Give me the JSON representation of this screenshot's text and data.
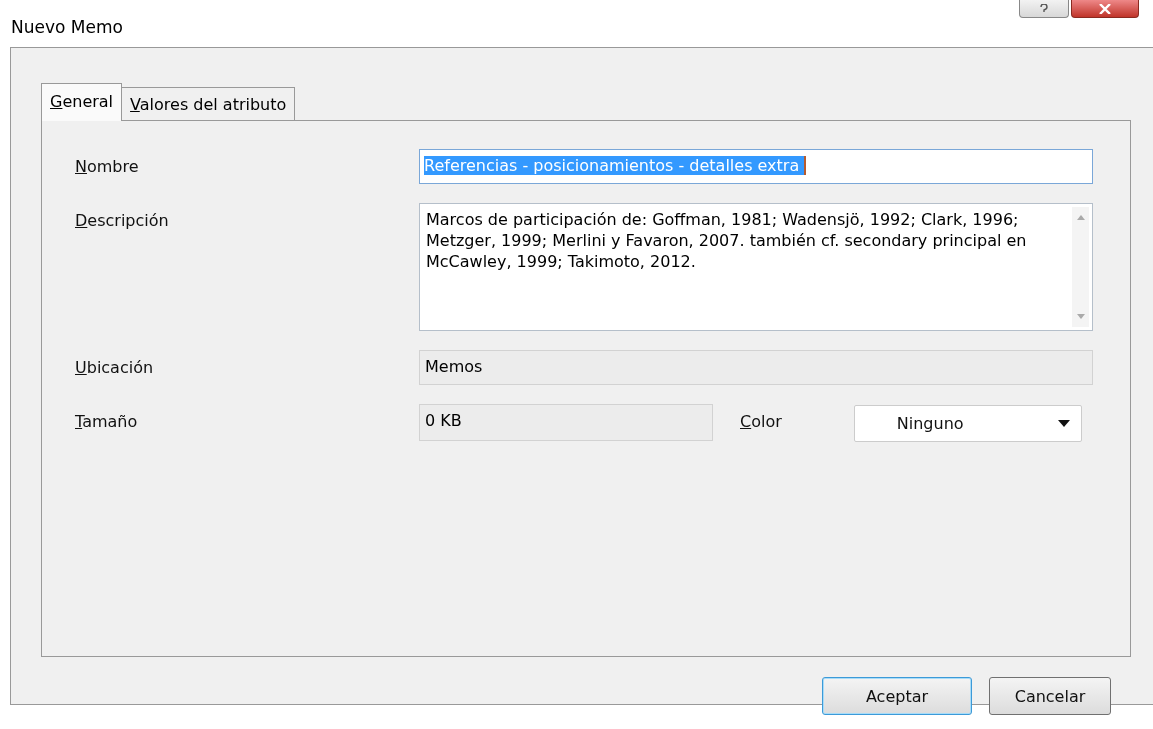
{
  "window": {
    "title": "Nuevo Memo"
  },
  "tabs": [
    {
      "label": "General",
      "selected": true
    },
    {
      "label": "Valores del atributo",
      "selected": false
    }
  ],
  "fields": {
    "name": {
      "label": "Nombre",
      "value": "Referencias - posicionamientos - detalles extra ",
      "selected": true
    },
    "description": {
      "label": "Descripción",
      "value": "Marcos de participación de: Goffman, 1981; Wadensjö, 1992; Clark, 1996; Metzger, 1999; Merlini y Favaron, 2007. también cf. secondary principal en McCawley, 1999; Takimoto, 2012."
    },
    "location": {
      "label": "Ubicación",
      "value": "Memos"
    },
    "size": {
      "label": "Tamaño",
      "value": "0 KB"
    },
    "color": {
      "label": "Color",
      "value": "Ninguno"
    }
  },
  "buttons": [
    {
      "label": "Aceptar",
      "kind": "default"
    },
    {
      "label": "Cancelar",
      "kind": "normal"
    }
  ]
}
